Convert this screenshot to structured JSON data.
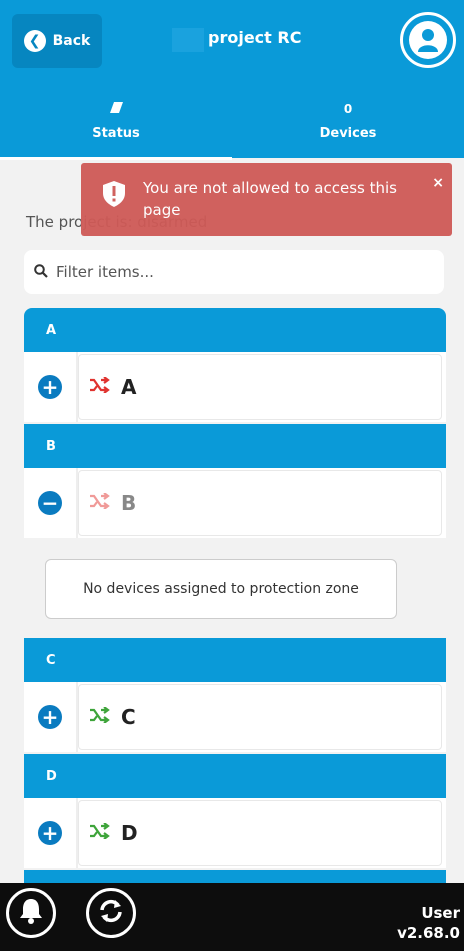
{
  "header": {
    "back_label": "Back",
    "title": "project RC",
    "back_icon": "chevron-left-icon",
    "avatar_icon": "user-icon"
  },
  "tabs": [
    {
      "label": "Status",
      "icon": "eraser-icon",
      "active": true
    },
    {
      "label": "Devices",
      "icon": "zero-count-icon",
      "count": "0",
      "active": false
    }
  ],
  "project_text": "The project is: disarmed",
  "filter": {
    "placeholder": "Filter items...",
    "value": ""
  },
  "zones": [
    {
      "header": "A",
      "name": "A",
      "expanded": false,
      "icon_color": "#e0332f"
    },
    {
      "header": "B",
      "name": "B",
      "expanded": true,
      "icon_color": "#f09a98"
    },
    {
      "header": "C",
      "name": "C",
      "expanded": false,
      "icon_color": "#3ea43a"
    },
    {
      "header": "D",
      "name": "D",
      "expanded": false,
      "icon_color": "#3ea43a"
    }
  ],
  "zone_b_empty_text": "No devices assigned to protection zone",
  "toast": {
    "message": "You are not allowed to access this page",
    "close": "×"
  },
  "footer": {
    "user_label": "User",
    "version": "v2.68.0"
  },
  "colors": {
    "primary": "#0a9ad8",
    "danger": "#cf5a57",
    "footer": "#0d0d0d"
  }
}
